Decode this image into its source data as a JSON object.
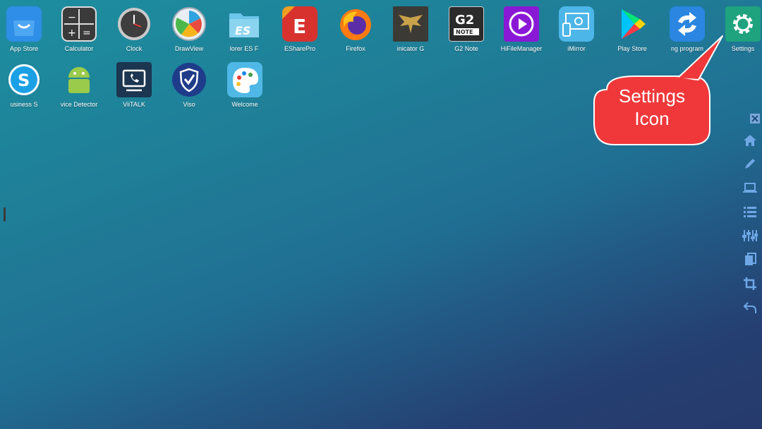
{
  "apps_row1": [
    {
      "id": "app-store",
      "label": "App Store",
      "icon": "shopping-bag-icon",
      "color": "#2f8ee8"
    },
    {
      "id": "calculator",
      "label": "Calculator",
      "icon": "calculator-icon",
      "color": "#3a3a3a"
    },
    {
      "id": "clock",
      "label": "Clock",
      "icon": "clock-icon",
      "color": "#4a4a4a"
    },
    {
      "id": "drawview",
      "label": "DrawView",
      "icon": "palette-wheel-icon",
      "color": "#ffffff"
    },
    {
      "id": "es-explorer",
      "label": "lorer      ES F",
      "icon": "folder-es-icon",
      "color": "#6cc5ea"
    },
    {
      "id": "esharepro",
      "label": "ESharePro",
      "icon": "eshare-icon",
      "color": "#d8322f"
    },
    {
      "id": "firefox",
      "label": "Firefox",
      "icon": "firefox-icon",
      "color": "#ff7a12"
    },
    {
      "id": "communicator",
      "label": "inicator      G",
      "icon": "phoenix-icon",
      "color": "#3b3a35"
    },
    {
      "id": "g2-note",
      "label": "G2 Note",
      "icon": "g2-note-icon",
      "color": "#2b2b2b"
    },
    {
      "id": "hifilemanager",
      "label": "HiFileManager",
      "icon": "play-circle-icon",
      "color": "#8a19d6"
    },
    {
      "id": "imirror",
      "label": "iMirror",
      "icon": "screen-mirror-icon",
      "color": "#4db6e8"
    },
    {
      "id": "play-store",
      "label": "Play Store",
      "icon": "play-store-icon",
      "color": "#ffffff"
    },
    {
      "id": "sync-program",
      "label": "ng program",
      "icon": "sync-arrows-icon",
      "color": "#2a86e0"
    },
    {
      "id": "settings",
      "label": "Settings",
      "icon": "gear-icon",
      "color": "#1fa37e"
    }
  ],
  "apps_row2": [
    {
      "id": "skype-business",
      "label": "usiness      S",
      "icon": "skype-icon",
      "color": "#1ba0e6"
    },
    {
      "id": "device-detector",
      "label": "vice Detector",
      "icon": "android-icon",
      "color": "#9acb4a"
    },
    {
      "id": "viitalk",
      "label": "ViiTALK",
      "icon": "video-call-icon",
      "color": "#1c3550"
    },
    {
      "id": "viso",
      "label": "Viso",
      "icon": "shield-check-icon",
      "color": "#1f3c8a"
    },
    {
      "id": "welcome",
      "label": "Welcome",
      "icon": "paint-palette-icon",
      "color": "#4fb8e6"
    }
  ],
  "callout": {
    "line1": "Settings",
    "line2": "Icon",
    "color": "#f0383a"
  },
  "toolbar": [
    "close-icon",
    "home-icon",
    "pen-icon",
    "laptop-icon",
    "list-icon",
    "equalizer-icon",
    "copy-icon",
    "crop-icon",
    "undo-icon"
  ],
  "accent": "#1fa37e"
}
